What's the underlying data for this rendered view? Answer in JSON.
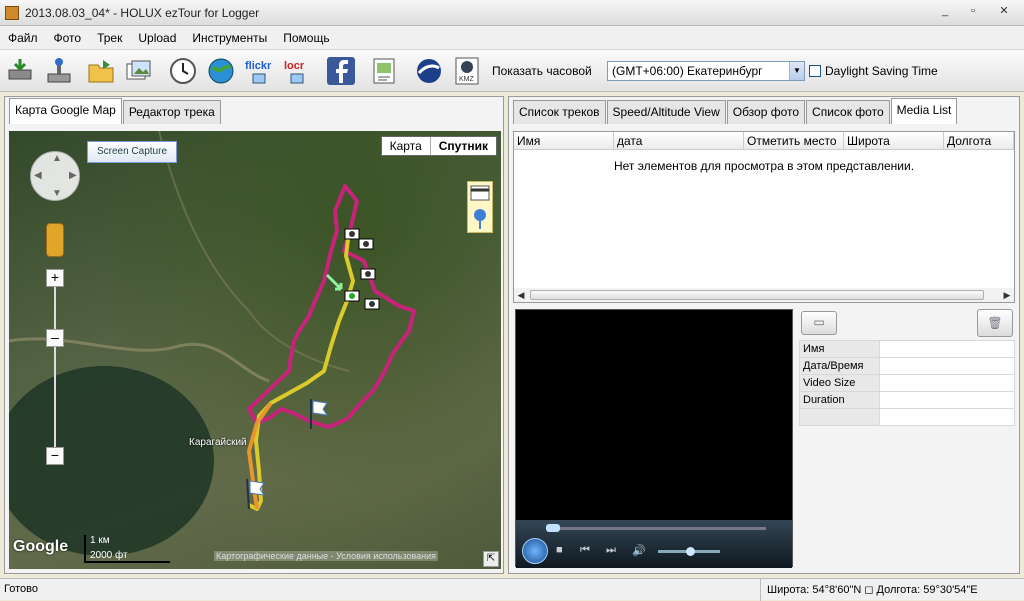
{
  "window": {
    "title": "2013.08.03_04* - HOLUX ezTour for Logger",
    "min": "_",
    "max": "▫",
    "close": "✕"
  },
  "menu": [
    "Файл",
    "Фото",
    "Трек",
    "Upload",
    "Инструменты",
    "Помощь"
  ],
  "toolbar": {
    "timezone_label": "Показать часовой",
    "timezone_value": "(GMT+06:00) Екатеринбург",
    "dst_label": "Daylight Saving Time",
    "flickr_text": "flickr",
    "locr_text": "locr",
    "kmz_text": "KMZ"
  },
  "left_panel": {
    "tabs": [
      "Карта Google Map",
      "Редактор трека"
    ],
    "map": {
      "screen_capture": "Screen Capture",
      "type_map": "Карта",
      "type_satellite": "Спутник",
      "zoom_plus": "+",
      "zoom_minus": "−",
      "place_label": "Карагайский",
      "google_logo": "Google",
      "scale_km": "1 км",
      "scale_ft": "2000 фт",
      "attribution": "Картографические данные - Условия использования"
    }
  },
  "right_panel": {
    "tabs": [
      "Список треков",
      "Speed/Altitude View",
      "Обзор фото",
      "Список фото",
      "Media List"
    ],
    "columns": [
      "Имя",
      "дата",
      "Отметить место",
      "Широта",
      "Долгота"
    ],
    "empty_message": "Нет элементов для просмотра в этом представлении.",
    "media_props": [
      "Имя",
      "Дата/Время",
      "Video Size",
      "Duration"
    ]
  },
  "status": {
    "left": "Готово",
    "right": "Широта: 54°8'60\"N ◻ Долгота: 59°30'54\"E"
  },
  "colors": {
    "track_pink": "#c8237a",
    "track_yellow": "#d9cc2a",
    "track_orange": "#e89530"
  }
}
